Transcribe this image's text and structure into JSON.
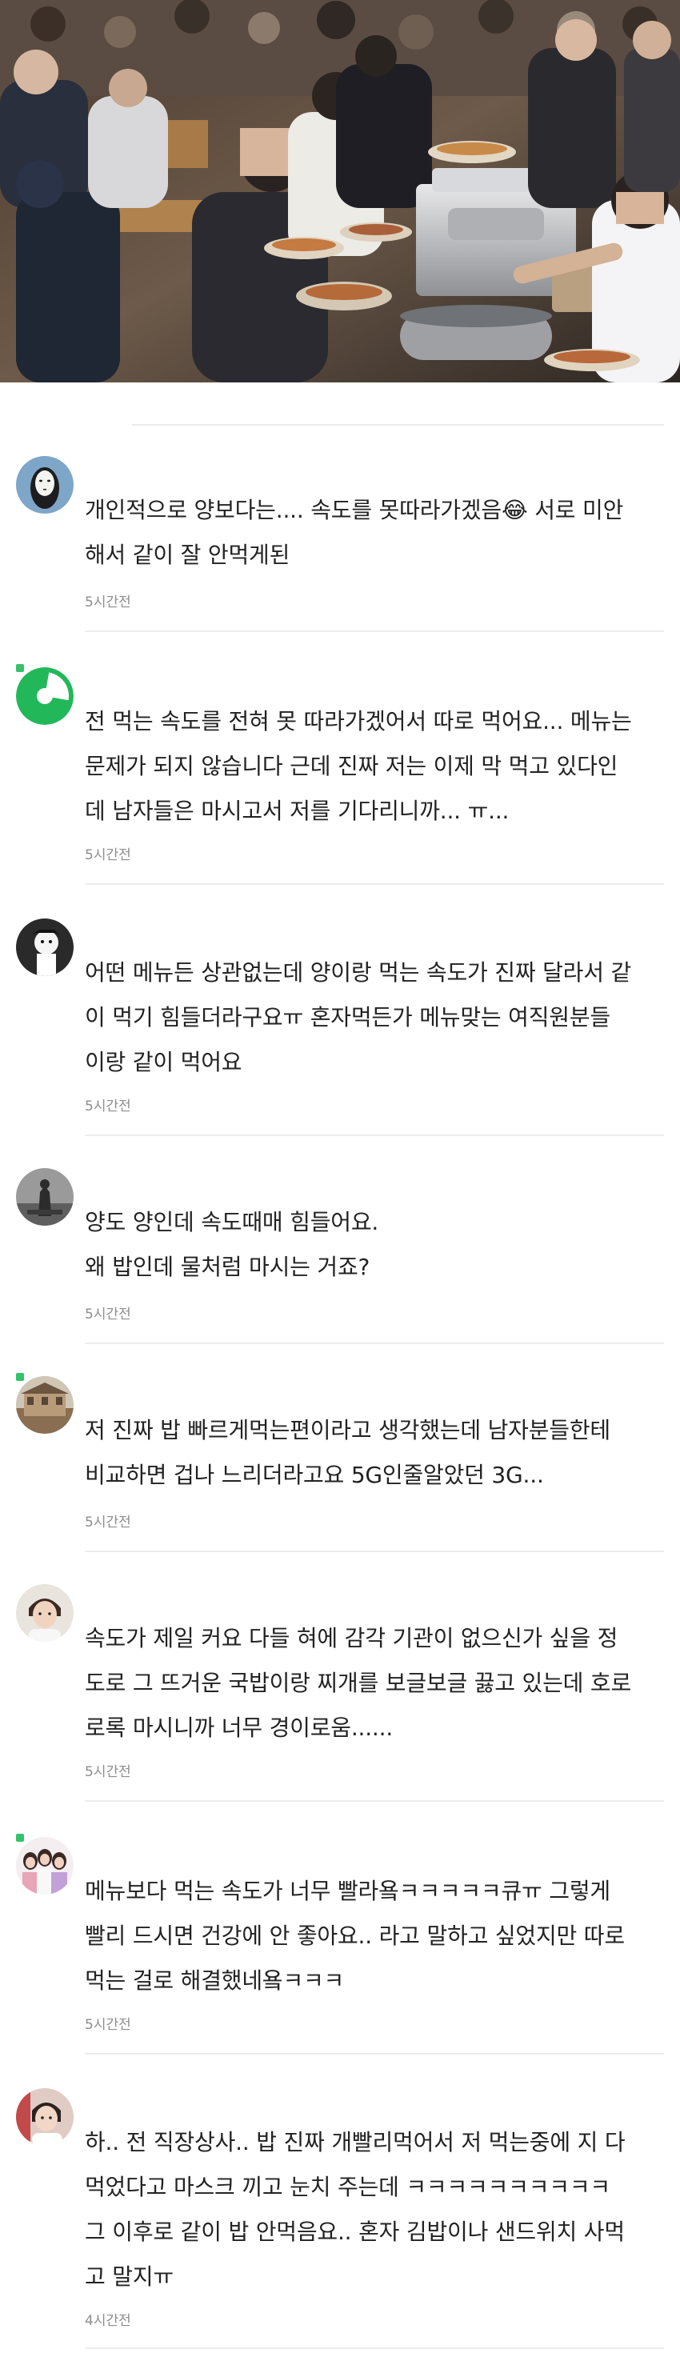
{
  "hero": {
    "image": "restaurant-buffet-photo"
  },
  "comments": [
    {
      "avatar": "no-face-character",
      "text": "개인적으로 양보다는.... 속도를 못따라가겠음😂 서로 미안\n해서 같이 잘 안먹게된",
      "time": "5시간전"
    },
    {
      "avatar": "green-pie",
      "text": "전 먹는 속도를 전혀 못 따라가겠어서 따로 먹어요... 메뉴는\n문제가 되지 않습니다 근데 진짜 저는 이제 막 먹고 있다인\n데 남자들은 마시고서 저를 기다리니까... ㅠ...",
      "time": "5시간전"
    },
    {
      "avatar": "cartoon-character",
      "text": "어떤 메뉴든 상관없는데 양이랑 먹는 속도가 진짜 달라서 같\n이 먹기 힘들더라구요ㅠ 혼자먹든가 메뉴맞는 여직원분들\n이랑 같이 먹어요",
      "time": "5시간전"
    },
    {
      "avatar": "statue-photo",
      "text": "양도 양인데 속도때매 힘들어요.\n왜 밥인데 물처럼 마시는 거죠?",
      "time": "5시간전"
    },
    {
      "avatar": "building-photo",
      "text": "저 진짜 밥 빠르게먹는편이라고 생각했는데 남자분들한테\n비교하면 겁나 느리더라고요 5G인줄알았던 3G...",
      "time": "5시간전"
    },
    {
      "avatar": "person-photo",
      "text": "속도가 제일 커요 다들 혀에 감각 기관이 없으신가 싶을 정\n도로 그 뜨거운 국밥이랑 찌개를 보글보글 끓고 있는데 호로\n로록 마시니까 너무 경이로움......",
      "time": "5시간전"
    },
    {
      "avatar": "group-photo",
      "text": "메뉴보다 먹는 속도가 너무 빨라욬ㅋㅋㅋㅋㅋ큐ㅠ 그렇게\n빨리 드시면 건강에 안 좋아요.. 라고 말하고 싶었지만 따로\n먹는 걸로 해결했네욬ㅋㅋㅋ",
      "time": "5시간전"
    },
    {
      "avatar": "portrait-photo",
      "text": "하.. 전 직장상사.. 밥 진짜 개빨리먹어서 저 먹는중에 지 다\n먹었다고 마스크 끼고 눈치 주는데 ㅋㅋㅋㅋㅋㅋㅋㅋㅋㅋ\n그 이후로 같이 밥 안먹음요.. 혼자 김밥이나 샌드위치 사먹\n고 말지ㅠ",
      "time": "4시간전"
    }
  ]
}
